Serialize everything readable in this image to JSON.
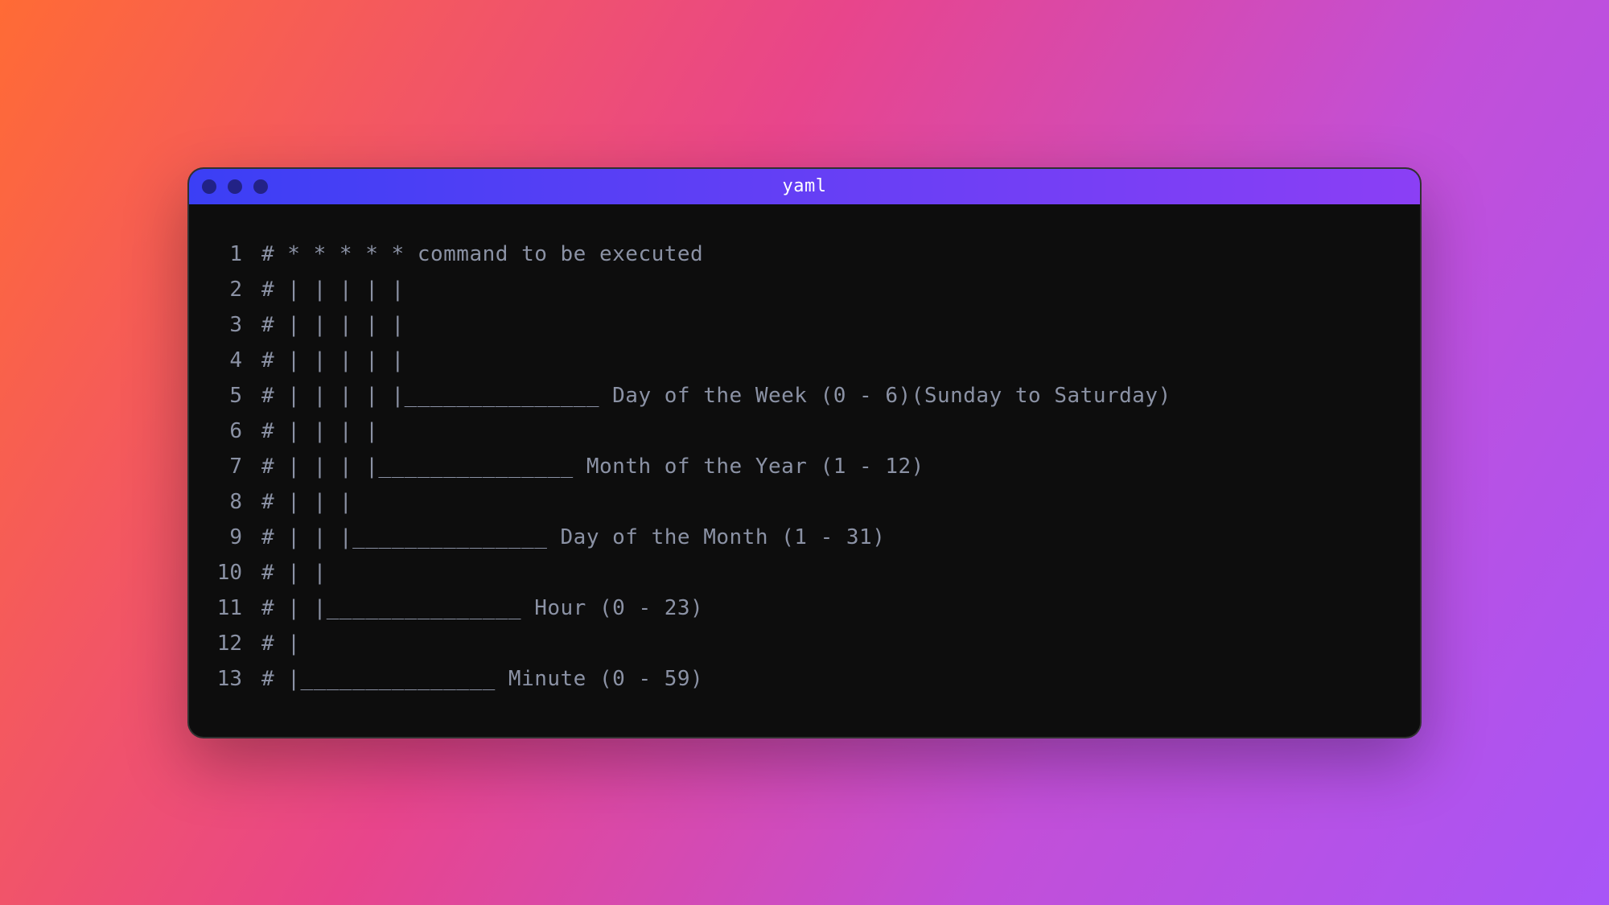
{
  "window": {
    "title": "yaml"
  },
  "editor": {
    "lines": [
      {
        "num": "1",
        "content": "# * * * * * command to be executed"
      },
      {
        "num": "2",
        "content": "# | | | | |"
      },
      {
        "num": "3",
        "content": "# | | | | |"
      },
      {
        "num": "4",
        "content": "# | | | | |"
      },
      {
        "num": "5",
        "content": "# | | | | |_______________ Day of the Week (0 - 6)(Sunday to Saturday)"
      },
      {
        "num": "6",
        "content": "# | | | |"
      },
      {
        "num": "7",
        "content": "# | | | |_______________ Month of the Year (1 - 12)"
      },
      {
        "num": "8",
        "content": "# | | |"
      },
      {
        "num": "9",
        "content": "# | | |_______________ Day of the Month (1 - 31)"
      },
      {
        "num": "10",
        "content": "# | |"
      },
      {
        "num": "11",
        "content": "# | |_______________ Hour (0 - 23)"
      },
      {
        "num": "12",
        "content": "# |"
      },
      {
        "num": "13",
        "content": "# |_______________ Minute (0 - 59)"
      }
    ]
  }
}
